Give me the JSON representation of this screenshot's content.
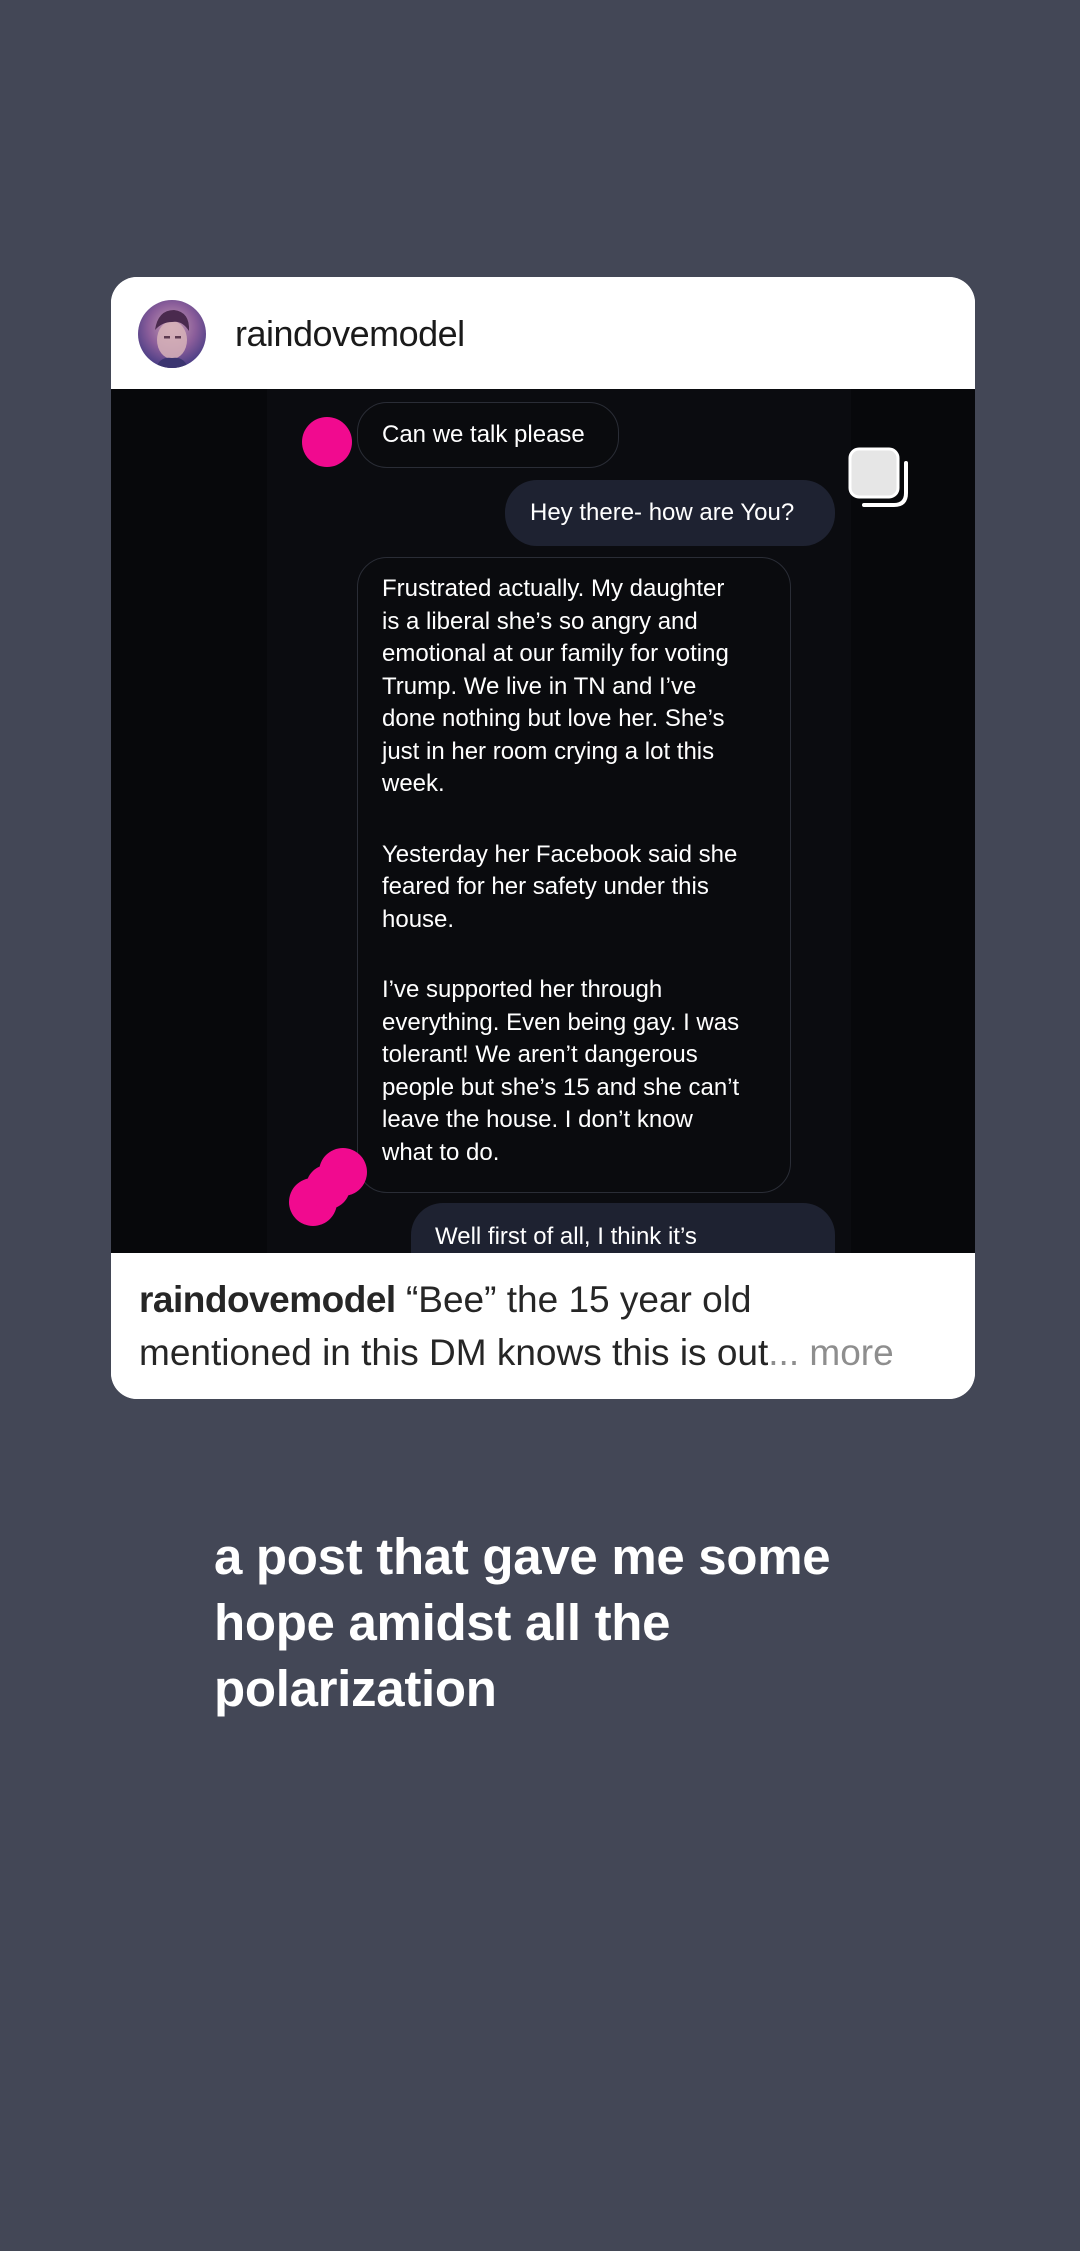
{
  "post": {
    "username": "raindovemodel",
    "messages": [
      {
        "side": "incoming",
        "text": "Can we talk please"
      },
      {
        "side": "outgoing",
        "text": "Hey there- how are You?"
      },
      {
        "side": "incoming",
        "paragraphs": [
          "Frustrated actually. My daughter\nis a liberal she’s so angry and\nemotional at our family for voting\nTrump. We live in TN and I’ve\ndone nothing but love her. She’s\njust in her room crying a lot this\nweek.",
          "Yesterday her Facebook said she\nfeared for her safety under this\nhouse.",
          "I’ve supported her through\neverything. Even being gay. I was\ntolerant! We aren’t dangerous\npeople but she’s 15 and she can’t\nleave the house. I don’t know\nwhat to do."
        ]
      },
      {
        "side": "outgoing",
        "text": "Well first of all, I think it’s"
      }
    ],
    "caption": {
      "username": "raindovemodel",
      "text_line1": " “Bee” the 15 year old",
      "text_line2": "mentioned in this DM knows this is out",
      "ellipsis": "...",
      "more": " more"
    },
    "icons": {
      "multi_image": "copy-stack-icon",
      "avatar": "profile-avatar"
    },
    "colors": {
      "redaction_pink": "#f10a8f",
      "outgoing_bubble": "#1e2231"
    }
  },
  "story_text": "a post that gave me some\nhope amidst all the\npolarization"
}
